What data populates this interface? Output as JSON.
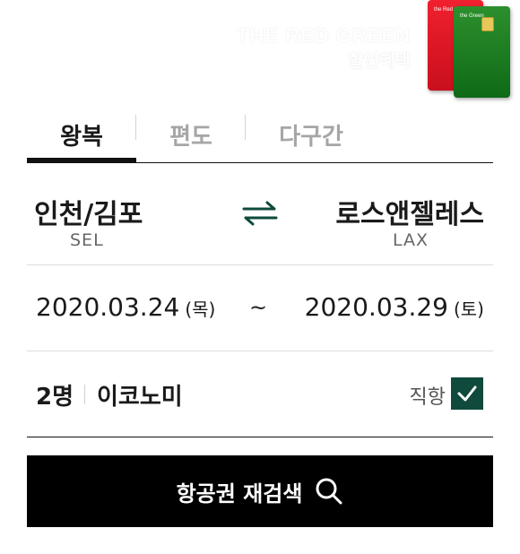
{
  "banner": {
    "title": "THE RED GREEN",
    "subtitle": "할인혜택",
    "card_red_text": "the Red",
    "card_green_text": "the Green"
  },
  "tabs": [
    {
      "label": "왕복",
      "active": true
    },
    {
      "label": "편도",
      "active": false
    },
    {
      "label": "다구간",
      "active": false
    }
  ],
  "route": {
    "from_city": "인천/김포",
    "from_code": "SEL",
    "to_city": "로스앤젤레스",
    "to_code": "LAX",
    "swap_icon": "swap-arrows-icon"
  },
  "dates": {
    "depart": "2020.03.24",
    "depart_day": "(목)",
    "separator": "~",
    "return": "2020.03.29",
    "return_day": "(토)"
  },
  "options": {
    "passengers": "2명",
    "cabin": "이코노미",
    "direct_label": "직항",
    "direct_checked": true
  },
  "search_button": {
    "label": "항공권 재검색",
    "icon": "search-icon"
  },
  "colors": {
    "accent": "#0f4a3c",
    "button_bg": "#000000",
    "card_red": "#e01a28",
    "card_green": "#1d7a22"
  }
}
